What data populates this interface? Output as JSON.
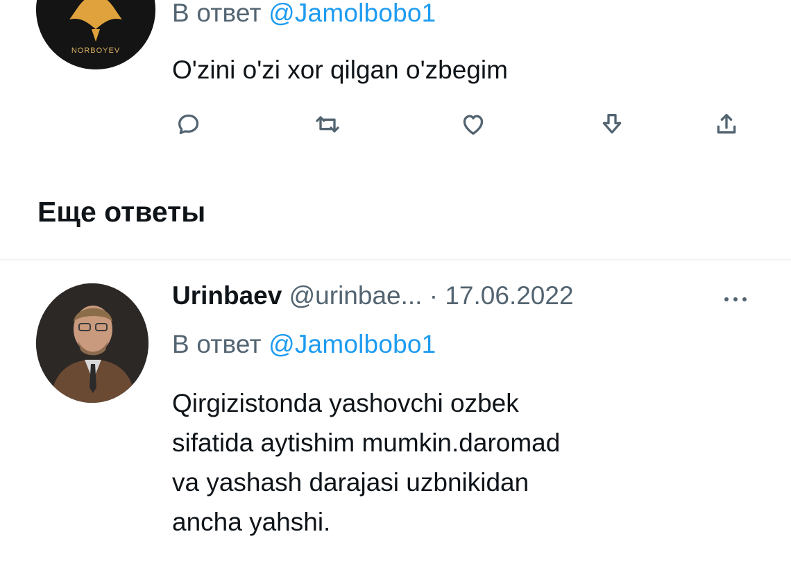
{
  "tweet1": {
    "avatar_text": "NORBOYEV",
    "reply_prefix": "В ответ",
    "reply_handle": "@Jamolbobo1",
    "text": "O'zini o'zi xor qilgan o'zbegim",
    "actions": [
      "reply-icon",
      "retweet-icon",
      "like-icon",
      "bookmark-icon",
      "share-icon"
    ]
  },
  "section": {
    "title": "Еще ответы"
  },
  "tweet2": {
    "name": "Urinbaev",
    "handle": "@urinbae...",
    "separator": "·",
    "date": "17.06.2022",
    "reply_prefix": "В ответ",
    "reply_handle": "@Jamolbobo1",
    "lines": [
      "Qirgizistonda yashovchi ozbek",
      "sifatida aytishim mumkin.daromad",
      "va yashash darajasi uzbnikidan",
      "ancha yahshi."
    ]
  },
  "colors": {
    "accent": "#1d9bf0",
    "muted": "#536471",
    "text": "#0f1419"
  }
}
